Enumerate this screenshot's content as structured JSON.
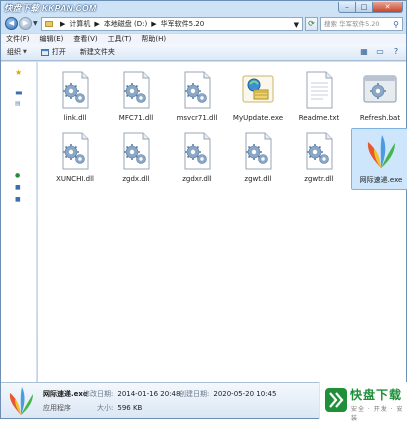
{
  "titlebar": {
    "logo_text": "快盘下载 KKPAN.COM",
    "min_label": "–",
    "max_label": "□",
    "close_label": "✕"
  },
  "address": {
    "crumbs": [
      "计算机",
      "本地磁盘 (D:)",
      "华军软件5.20"
    ],
    "search_placeholder": "搜索 华军软件5.20"
  },
  "menubar": {
    "items": [
      "文件(F)",
      "编辑(E)",
      "查看(V)",
      "工具(T)",
      "帮助(H)"
    ]
  },
  "commandbar": {
    "organize": "组织",
    "open": "打开",
    "new_folder": "新建文件夹"
  },
  "files": [
    {
      "name": "link.dll",
      "icon": "dll-gear-icon"
    },
    {
      "name": "MFC71.dll",
      "icon": "dll-gear-icon"
    },
    {
      "name": "msvcr71.dll",
      "icon": "dll-gear-icon"
    },
    {
      "name": "MyUpdate.exe",
      "icon": "update-exe-icon"
    },
    {
      "name": "Readme.txt",
      "icon": "text-file-icon"
    },
    {
      "name": "Refresh.bat",
      "icon": "batch-file-icon"
    },
    {
      "name": "XUNCHI.dll",
      "icon": "dll-gear-icon"
    },
    {
      "name": "zgdx.dll",
      "icon": "dll-gear-icon"
    },
    {
      "name": "zgdxr.dll",
      "icon": "dll-gear-icon"
    },
    {
      "name": "zgwt.dll",
      "icon": "dll-gear-icon"
    },
    {
      "name": "zgwtr.dll",
      "icon": "dll-gear-icon"
    },
    {
      "name": "网际速递.exe",
      "icon": "app-exe-icon",
      "selected": true
    }
  ],
  "details": {
    "name": "网际速递.exe",
    "type": "应用程序",
    "modified_label": "修改日期:",
    "modified_value": "2014-01-16 20:48",
    "created_label": "创建日期:",
    "created_value": "2020-05-20 10:45",
    "size_label": "大小:",
    "size_value": "596 KB"
  },
  "brand": {
    "title": "快盘下载",
    "subtitle": "安全 · 开发 · 安装"
  },
  "colors": {
    "accent": "#2f6fb8",
    "selection": "#cde6fb",
    "brand_green": "#1f8f3a"
  }
}
